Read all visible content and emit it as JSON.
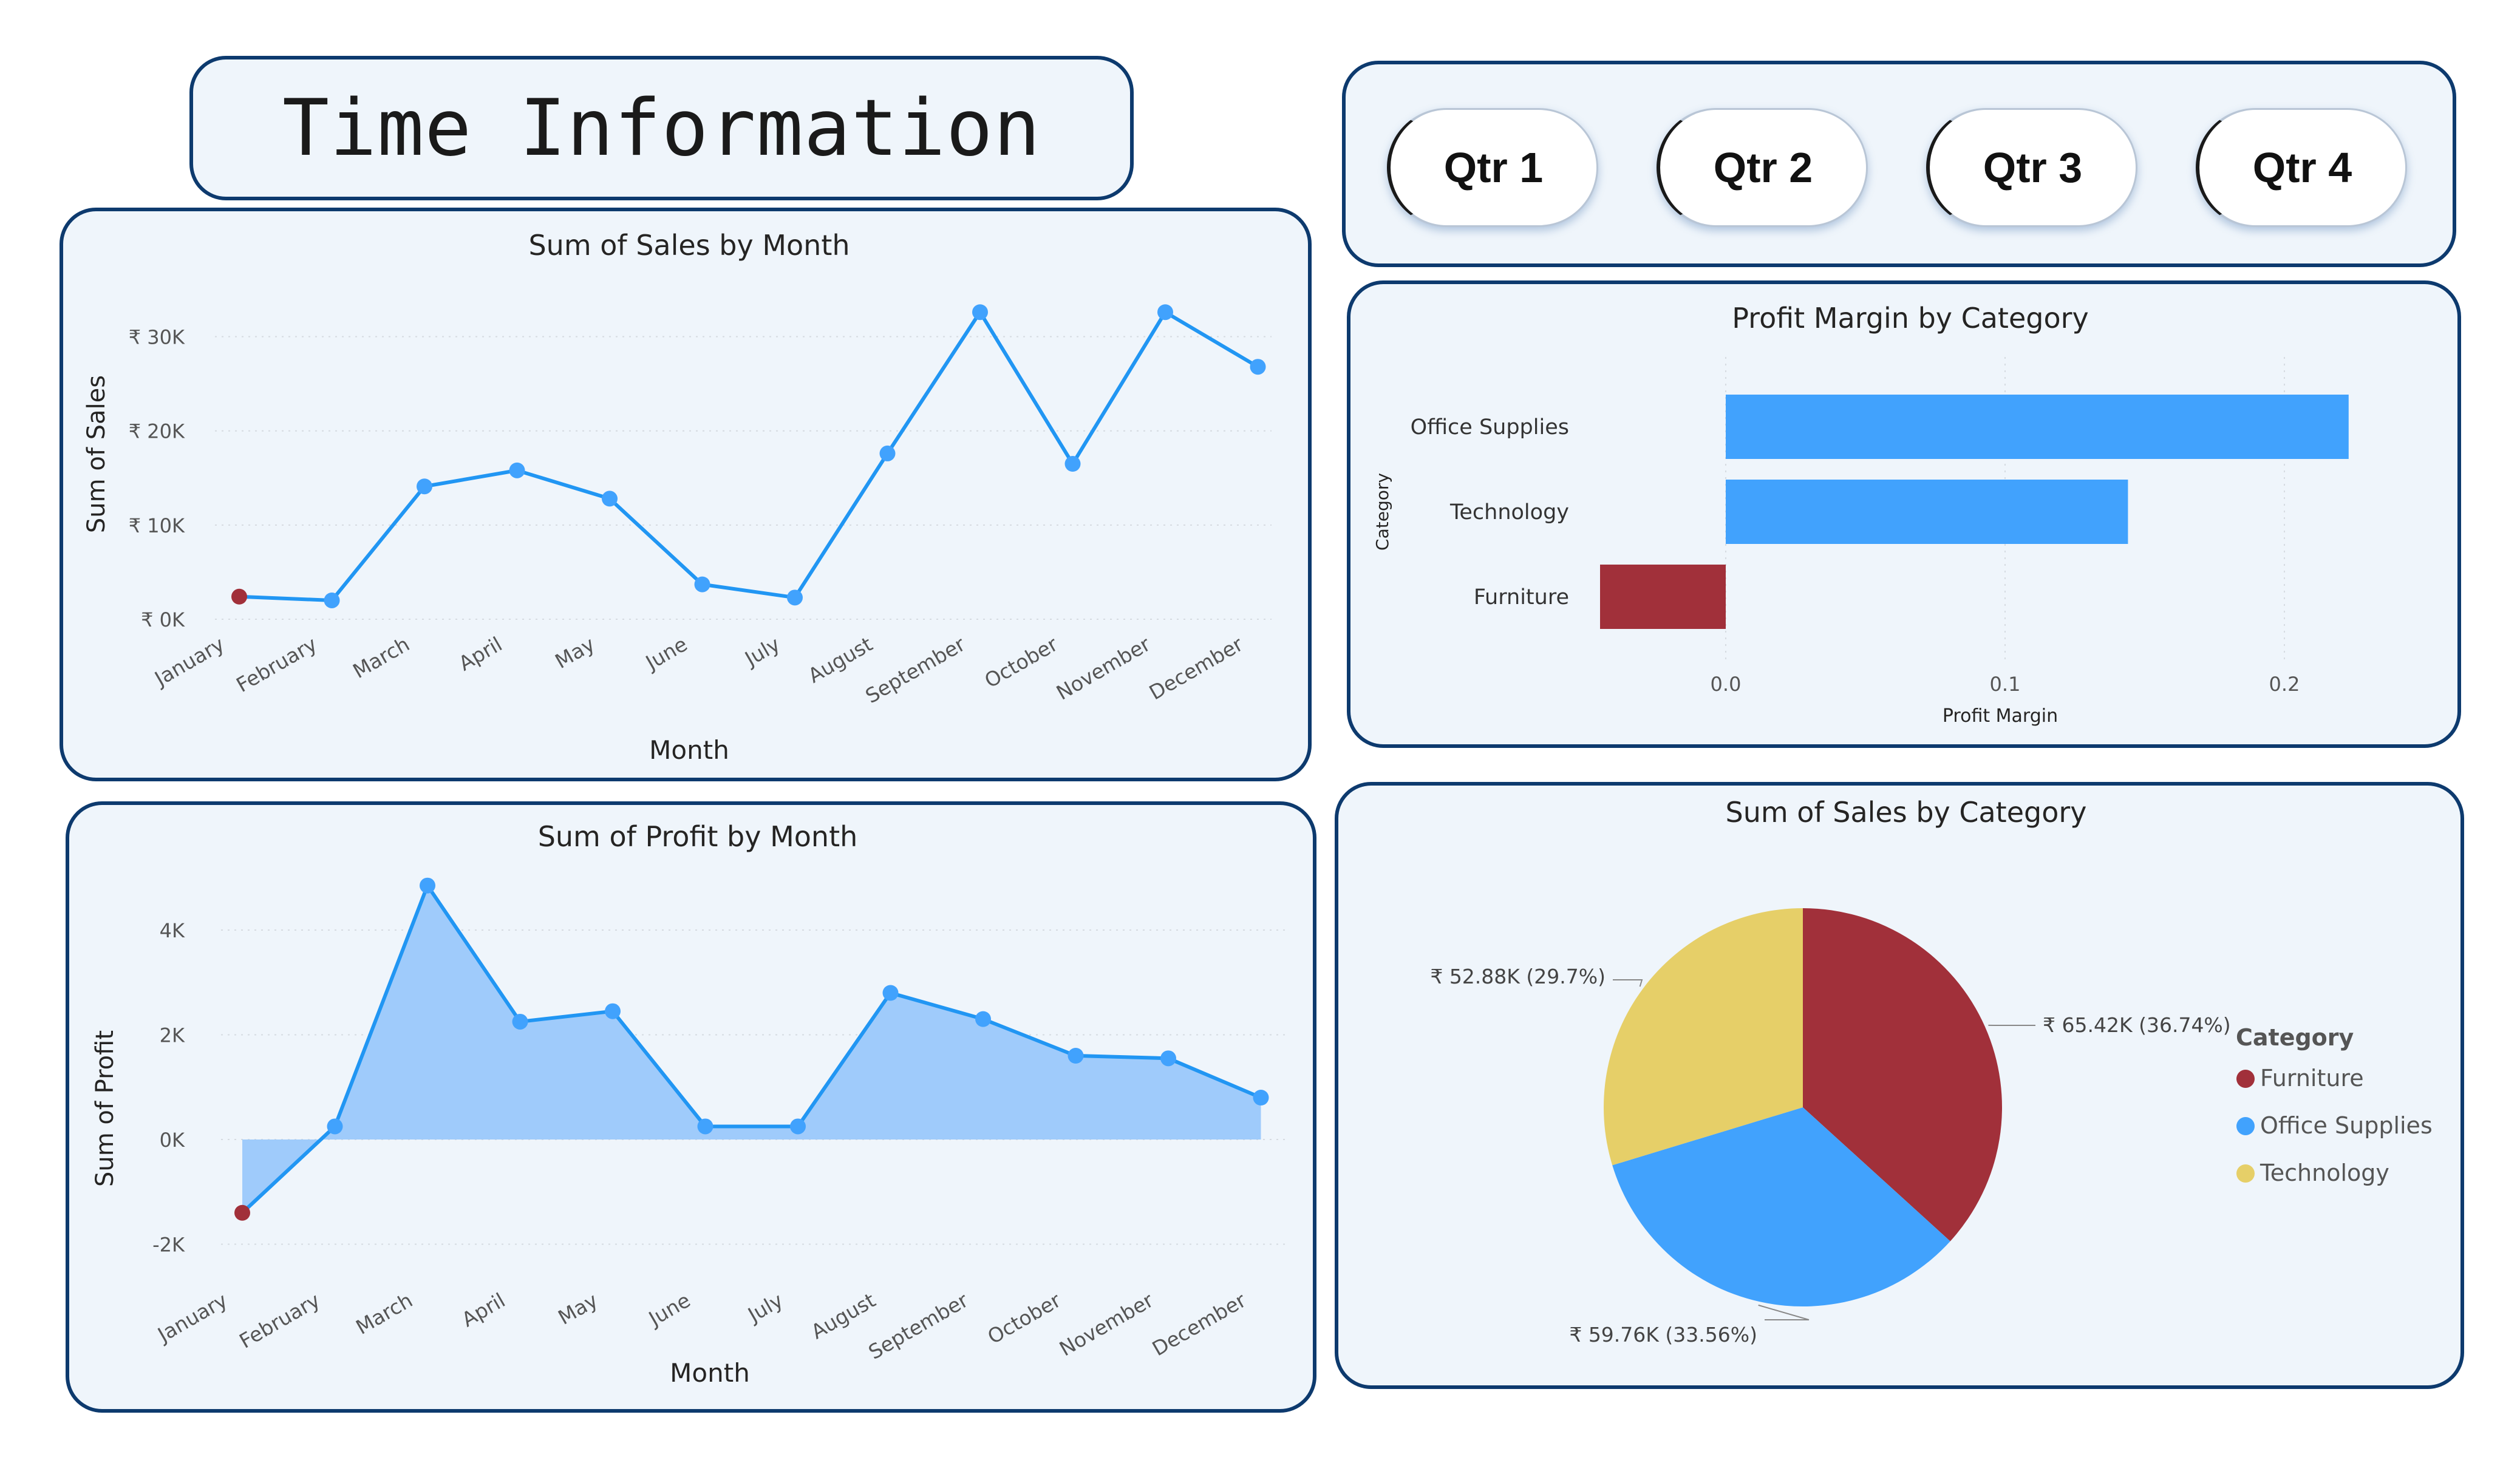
{
  "header": {
    "title": "Time Information"
  },
  "quarter_filters": [
    "Qtr 1",
    "Qtr 2",
    "Qtr 3",
    "Qtr 4"
  ],
  "colors": {
    "accent": "#2196f3",
    "highlight": "#a1303a",
    "furniture": "#a1303a",
    "office_supplies": "#41a2fd",
    "technology": "#e6cf68",
    "area_fill": "#9fcbfb",
    "border": "#0d3a6e"
  },
  "chart_data": [
    {
      "id": "sales_by_month",
      "type": "line",
      "title": "Sum of Sales by Month",
      "xlabel": "Month",
      "ylabel": "Sum of Sales",
      "categories": [
        "January",
        "February",
        "March",
        "April",
        "May",
        "June",
        "July",
        "August",
        "September",
        "October",
        "November",
        "December"
      ],
      "values": [
        2400,
        2000,
        14100,
        15800,
        12800,
        3700,
        2300,
        17600,
        32600,
        16500,
        32600,
        26800
      ],
      "yticks": [
        0,
        10000,
        20000,
        30000
      ],
      "ytick_labels": [
        "₹ 0K",
        "₹ 10K",
        "₹ 20K",
        "₹ 30K"
      ],
      "ylim": [
        0,
        33000
      ],
      "highlight_index": 0,
      "grid": true
    },
    {
      "id": "profit_by_month",
      "type": "area",
      "title": "Sum of Profit by Month",
      "xlabel": "Month",
      "ylabel": "Sum of Profit",
      "categories": [
        "January",
        "February",
        "March",
        "April",
        "May",
        "June",
        "July",
        "August",
        "September",
        "October",
        "November",
        "December"
      ],
      "values": [
        -1400,
        250,
        4850,
        2250,
        2450,
        250,
        250,
        2800,
        2300,
        1600,
        1550,
        800
      ],
      "yticks": [
        -2000,
        0,
        2000,
        4000
      ],
      "ytick_labels": [
        "-2K",
        "0K",
        "2K",
        "4K"
      ],
      "ylim": [
        -2200,
        4900
      ],
      "highlight_index": 0,
      "grid": true
    },
    {
      "id": "profit_margin_by_category",
      "type": "bar",
      "orientation": "horizontal",
      "title": "Profit Margin by Category",
      "xlabel": "Profit Margin",
      "ylabel": "Category",
      "categories": [
        "Office Supplies",
        "Technology",
        "Furniture"
      ],
      "values": [
        0.223,
        0.144,
        -0.045
      ],
      "xticks": [
        0.0,
        0.1,
        0.2
      ],
      "xtick_labels": [
        "0.0",
        "0.1",
        "0.2"
      ],
      "xlim": [
        -0.045,
        0.225
      ],
      "grid": true
    },
    {
      "id": "sales_by_category",
      "type": "pie",
      "title": "Sum of Sales by Category",
      "legend_title": "Category",
      "legend_position": "right",
      "slices": [
        {
          "name": "Furniture",
          "value": 65.42,
          "label": "₹ 65.42K (36.74%)"
        },
        {
          "name": "Office Supplies",
          "value": 59.76,
          "label": "₹ 59.76K (33.56%)"
        },
        {
          "name": "Technology",
          "value": 52.88,
          "label": "₹ 52.88K (29.7%)"
        }
      ]
    }
  ]
}
